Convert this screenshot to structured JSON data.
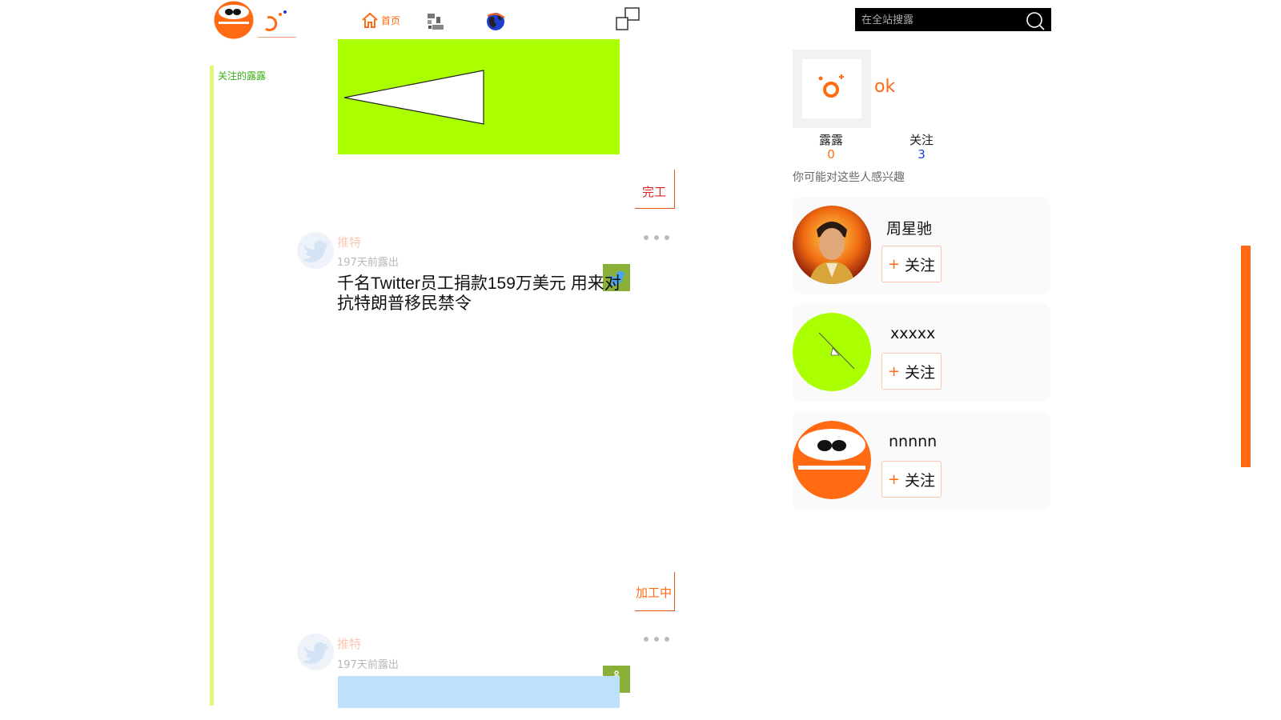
{
  "header": {
    "nav_home_label": "首页",
    "search_placeholder": "在全站搜露"
  },
  "sidebar": {
    "follow_link_label": "关注的露露"
  },
  "feed": {
    "status_done": "完工",
    "status_processing": "加工中",
    "posts": [
      {
        "author": "推特",
        "time": "197天前露出",
        "title": "千名Twitter员工捐款159万美元 用来对抗特朗普移民禁令",
        "badge_icon": "twitter-bird-icon"
      },
      {
        "author": "推特",
        "time": "197天前露出",
        "badge_icon": "info-icon"
      }
    ]
  },
  "profile": {
    "name": "ok",
    "stats": [
      {
        "label": "露露",
        "value": "0"
      },
      {
        "label": "关注",
        "value": "3"
      }
    ]
  },
  "suggestions": {
    "title": "你可能对这些人感兴趣",
    "follow_label": "关注",
    "follow_plus": "+",
    "people": [
      {
        "name": "周星驰",
        "avatar": "photo-avatar"
      },
      {
        "name": "xxxxx",
        "avatar": "green-circle-avatar"
      },
      {
        "name": "nnnnn",
        "avatar": "orange-face-avatar"
      }
    ]
  },
  "colors": {
    "accent": "#ff6a13",
    "lime": "#aaff00",
    "rail": "#e2f77a",
    "badge": "#8ab037",
    "done_red": "#d8202b"
  }
}
